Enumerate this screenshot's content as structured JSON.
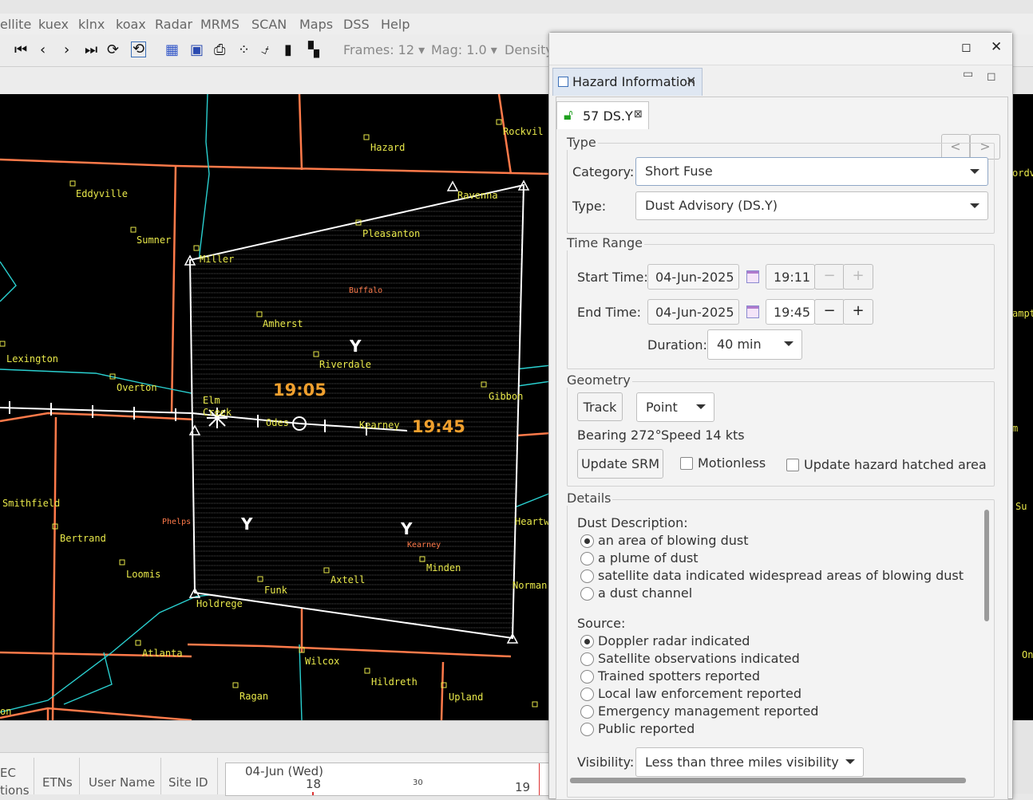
{
  "menubar": {
    "items": [
      "ellite",
      "kuex",
      "klnx",
      "koax",
      "Radar",
      "MRMS",
      "SCAN",
      "Maps",
      "DSS",
      "Help"
    ]
  },
  "toolbar": {
    "frames": "Frames: 12",
    "mag": "Mag: 1.0",
    "density": "Density"
  },
  "map": {
    "cities": [
      {
        "name": "Rockvil",
        "class": "city"
      },
      {
        "name": "Hazard"
      },
      {
        "name": "Eddyville"
      },
      {
        "name": "Sumner"
      },
      {
        "name": "Ravenna"
      },
      {
        "name": "Pleasanton"
      },
      {
        "name": "Miller"
      },
      {
        "name": "Buffalo"
      },
      {
        "name": "Amherst"
      },
      {
        "name": "Lexington"
      },
      {
        "name": "Riverdale"
      },
      {
        "name": "Overton"
      },
      {
        "name": "Gibbon"
      },
      {
        "name": "Elm"
      },
      {
        "name": "Creek"
      },
      {
        "name": "Odes"
      },
      {
        "name": "Kearney"
      },
      {
        "name": "Smithfield"
      },
      {
        "name": "Phelps"
      },
      {
        "name": "Bertrand"
      },
      {
        "name": "Heartw"
      },
      {
        "name": "Kearney"
      },
      {
        "name": "Minden"
      },
      {
        "name": "Loomis"
      },
      {
        "name": "Axtell"
      },
      {
        "name": "Norman"
      },
      {
        "name": "Funk"
      },
      {
        "name": "Holdrege"
      },
      {
        "name": "Atlanta"
      },
      {
        "name": "Wilcox"
      },
      {
        "name": "Hildreth"
      },
      {
        "name": "Ragan"
      },
      {
        "name": "Upland"
      }
    ],
    "hazard_marks": [
      "Y",
      "Y",
      "Y"
    ],
    "time_start": "19:05",
    "time_end": "19:45",
    "right_edge_labels": [
      "ordv",
      "ampt",
      "m",
      "Su",
      "On"
    ],
    "left_edge_labels": [
      "on"
    ],
    "line_color_roads": "#ff7a4a",
    "line_color_rivers": "#2ad0d0"
  },
  "bottom": {
    "col_ec": "EC",
    "col_tions": "tions",
    "col_etns": "ETNs",
    "col_user": "User Name",
    "col_site": "Site ID",
    "date_label": "04-Jun (Wed)",
    "hour_18": "18",
    "hour_19": "19",
    "tick_30": "30"
  },
  "dialog": {
    "view_title": "Hazard Information",
    "hazard_tab": "57 DS.Y",
    "nav_prev": "<",
    "nav_next": ">",
    "type_group": "Type",
    "category_label": "Category:",
    "category_value": "Short Fuse",
    "type_label": "Type:",
    "type_value": "Dust Advisory (DS.Y)",
    "time_group": "Time Range",
    "start_label": "Start Time:",
    "start_date": "04-Jun-2025",
    "start_time": "19:11",
    "end_label": "End Time:",
    "end_date": "04-Jun-2025",
    "end_time": "19:45",
    "duration_label": "Duration:",
    "duration_value": "40 min",
    "minus": "−",
    "plus": "+",
    "geometry_group": "Geometry",
    "track_button": "Track",
    "point_value": "Point",
    "bearing": "Bearing 272°",
    "speed": "Speed 14 kts",
    "update_srm": "Update SRM",
    "motionless": "Motionless",
    "update_hatched": "Update hazard hatched area",
    "details_group": "Details",
    "dust_desc_label": "Dust Description:",
    "dust_options": [
      "an area of blowing dust",
      "a plume of dust",
      "satellite data indicated widespread areas of blowing dust",
      "a dust channel"
    ],
    "dust_selected": 0,
    "source_label": "Source:",
    "source_options": [
      "Doppler radar indicated",
      "Satellite observations indicated",
      "Trained spotters reported",
      "Local law enforcement reported",
      "Emergency management reported",
      "Public reported"
    ],
    "source_selected": 0,
    "visibility_label": "Visibility:",
    "visibility_value": "Less than three miles visibility"
  }
}
